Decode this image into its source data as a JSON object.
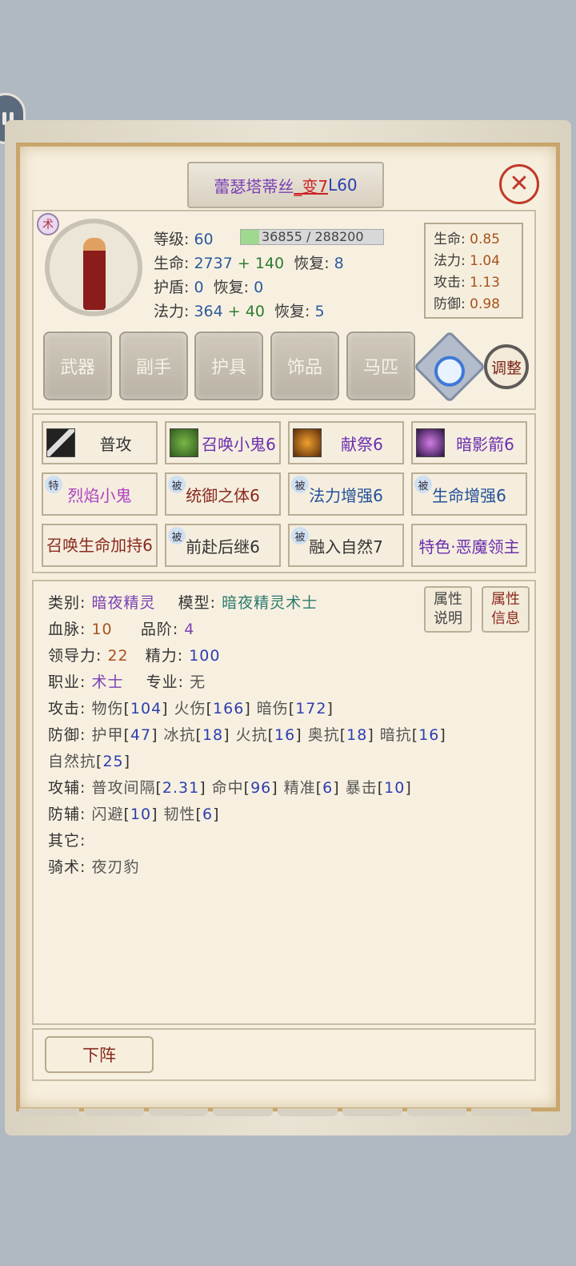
{
  "header": {
    "name": "蕾瑟塔蒂丝",
    "suffix": "_变7",
    "level_tag": "L60"
  },
  "colors": {
    "name": "#7a3fb5",
    "suffix": "#cc2222",
    "level": "#2b3fb0",
    "frame": "#c9a66c"
  },
  "portrait": {
    "badge": "术"
  },
  "stats": {
    "level_label": "等级:",
    "level": "60",
    "exp_text": "36855 / 288200",
    "exp_fraction": 0.128,
    "hp_label": "生命:",
    "hp_base": "2737",
    "hp_plus": "+ 140",
    "hp_regen_label": "恢复:",
    "hp_regen": "8",
    "shield_label": "护盾:",
    "shield": "0",
    "shield_regen_label": "恢复:",
    "shield_regen": "0",
    "mp_label": "法力:",
    "mp_base": "364",
    "mp_plus": "+ 40",
    "mp_regen_label": "恢复:",
    "mp_regen": "5"
  },
  "ratios": [
    {
      "label": "生命:",
      "value": "0.85"
    },
    {
      "label": "法力:",
      "value": "1.04"
    },
    {
      "label": "攻击:",
      "value": "1.13"
    },
    {
      "label": "防御:",
      "value": "0.98"
    }
  ],
  "equipment": [
    "武器",
    "副手",
    "护具",
    "饰品",
    "马匹"
  ],
  "adjust_label": "调整",
  "skills": [
    {
      "label": "普攻",
      "icon": "sword-icon",
      "tag": ""
    },
    {
      "label": "召唤小鬼6",
      "icon": "imp-icon",
      "tag": ""
    },
    {
      "label": "献祭6",
      "icon": "sacrifice-icon",
      "tag": ""
    },
    {
      "label": "暗影箭6",
      "icon": "shadowbolt-icon",
      "tag": ""
    },
    {
      "label": "烈焰小鬼",
      "icon": "",
      "tag": "特"
    },
    {
      "label": "统御之体6",
      "icon": "",
      "tag": "被"
    },
    {
      "label": "法力增强6",
      "icon": "",
      "tag": "被"
    },
    {
      "label": "生命增强6",
      "icon": "",
      "tag": "被"
    },
    {
      "label": "召唤生命加持6",
      "icon": "",
      "tag": ""
    },
    {
      "label": "前赴后继6",
      "icon": "",
      "tag": "被"
    },
    {
      "label": "融入自然7",
      "icon": "",
      "tag": "被"
    },
    {
      "label": "特色·恶魔领主",
      "icon": "",
      "tag": ""
    }
  ],
  "attr_buttons": {
    "desc_line1": "属性",
    "desc_line2": "说明",
    "info_line1": "属性",
    "info_line2": "信息"
  },
  "info": {
    "category_label": "类别:",
    "category": "暗夜精灵",
    "model_label": "模型:",
    "model": "暗夜精灵术士",
    "bloodline_label": "血脉:",
    "bloodline": "10",
    "grade_label": "品阶:",
    "grade": "4",
    "leadership_label": "领导力:",
    "leadership": "22",
    "energy_label": "精力:",
    "energy": "100",
    "job_label": "职业:",
    "job": "术士",
    "spec_label": "专业:",
    "spec": "无",
    "attack_label": "攻击:",
    "attack_items": [
      {
        "name": "物伤",
        "value": "104"
      },
      {
        "name": "火伤",
        "value": "166"
      },
      {
        "name": "暗伤",
        "value": "172"
      }
    ],
    "defense_label": "防御:",
    "defense_items": [
      {
        "name": "护甲",
        "value": "47"
      },
      {
        "name": "冰抗",
        "value": "18"
      },
      {
        "name": "火抗",
        "value": "16"
      },
      {
        "name": "奥抗",
        "value": "18"
      },
      {
        "name": "暗抗",
        "value": "16"
      },
      {
        "name": "自然抗",
        "value": "25"
      }
    ],
    "atk_aux_label": "攻辅:",
    "atk_aux_items": [
      {
        "name": "普攻间隔",
        "value": "2.31"
      },
      {
        "name": "命中",
        "value": "96"
      },
      {
        "name": "精准",
        "value": "6"
      },
      {
        "name": "暴击",
        "value": "10"
      }
    ],
    "def_aux_label": "防辅:",
    "def_aux_items": [
      {
        "name": "闪避",
        "value": "10"
      },
      {
        "name": "韧性",
        "value": "6"
      }
    ],
    "other_label": "其它:",
    "riding_label": "骑术:",
    "riding": "夜刃豹"
  },
  "deploy_label": "下阵"
}
